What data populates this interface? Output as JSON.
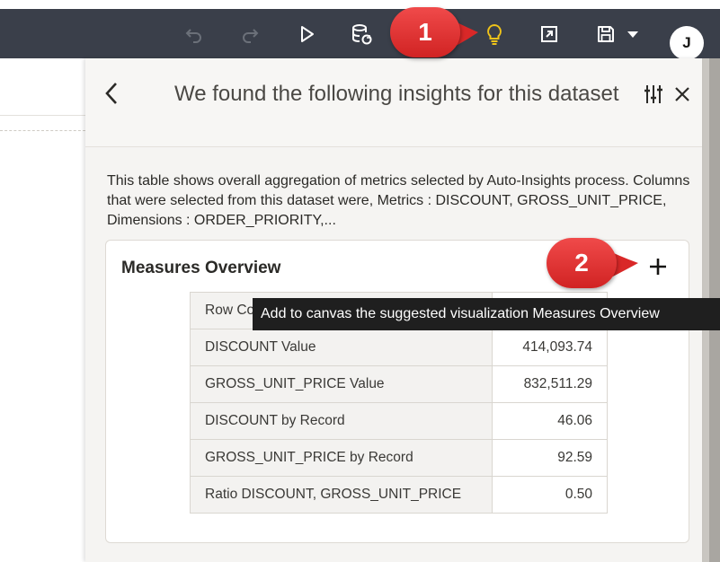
{
  "toolbar": {
    "icons": [
      "undo-icon",
      "redo-icon",
      "play-icon",
      "data-refresh-icon",
      "lightbulb-icon",
      "present-icon",
      "save-icon",
      "caret-down-icon"
    ],
    "user_initial": "J"
  },
  "panel": {
    "title": "We found the following insights for this dataset",
    "description": "This table shows overall aggregation of metrics selected by Auto-Insights process. Columns that were selected from this dataset were, Metrics : DISCOUNT, GROSS_UNIT_PRICE, Dimensions : ORDER_PRIORITY,..."
  },
  "card": {
    "title": "Measures Overview",
    "rows": [
      {
        "label": "Row Co",
        "value": ""
      },
      {
        "label": "DISCOUNT Value",
        "value": "414,093.74"
      },
      {
        "label": "GROSS_UNIT_PRICE Value",
        "value": "832,511.29"
      },
      {
        "label": "DISCOUNT by Record",
        "value": "46.06"
      },
      {
        "label": "GROSS_UNIT_PRICE by Record",
        "value": "92.59"
      },
      {
        "label": "Ratio DISCOUNT, GROSS_UNIT_PRICE",
        "value": "0.50"
      }
    ]
  },
  "tooltip": {
    "text": "Add to canvas the suggested visualization Measures Overview"
  },
  "callouts": {
    "one": "1",
    "two": "2"
  },
  "colors": {
    "toolbar_bg": "#3a3f4a",
    "callout_red": "#e23434",
    "lightbulb_yellow": "#f0c419"
  }
}
